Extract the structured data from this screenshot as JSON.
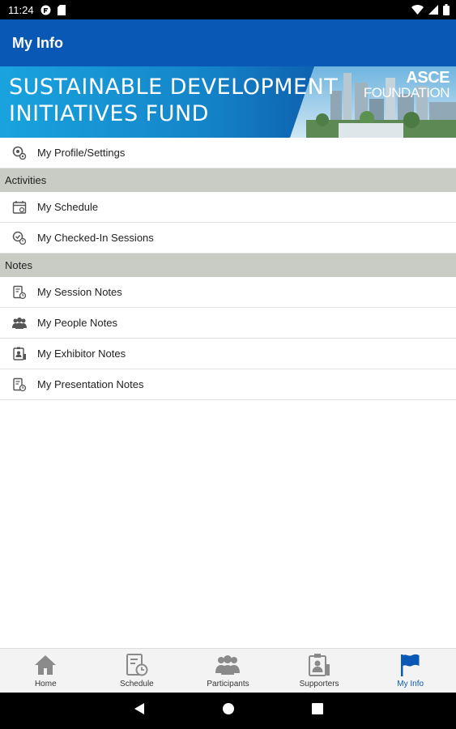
{
  "status_bar": {
    "time": "11:24"
  },
  "app_bar": {
    "title": "My Info"
  },
  "banner": {
    "line1": "SUSTAINABLE DEVELOPMENT",
    "line2": "INITIATIVES FUND",
    "logo_line1": "ASCE",
    "logo_line2": "FOUNDATION"
  },
  "profile": {
    "label": "My Profile/Settings",
    "icon": "gear-person-icon"
  },
  "sections": [
    {
      "header": "Activities",
      "items": [
        {
          "label": "My Schedule",
          "icon": "calendar-icon"
        },
        {
          "label": "My Checked-In Sessions",
          "icon": "check-in-icon"
        }
      ]
    },
    {
      "header": "Notes",
      "items": [
        {
          "label": "My Session Notes",
          "icon": "notes-clock-icon"
        },
        {
          "label": "My People Notes",
          "icon": "people-icon"
        },
        {
          "label": "My Exhibitor Notes",
          "icon": "badge-icon"
        },
        {
          "label": "My Presentation Notes",
          "icon": "notes-clock-icon"
        }
      ]
    }
  ],
  "bottom_nav": [
    {
      "label": "Home",
      "icon": "home-icon"
    },
    {
      "label": "Schedule",
      "icon": "schedule-icon"
    },
    {
      "label": "Participants",
      "icon": "participants-icon"
    },
    {
      "label": "Supporters",
      "icon": "supporters-icon"
    },
    {
      "label": "My Info",
      "icon": "flag-icon",
      "active": true
    }
  ],
  "colors": {
    "primary": "#0a58b5",
    "section_header_bg": "#c8ccc4",
    "active_nav": "#0a58b5"
  }
}
